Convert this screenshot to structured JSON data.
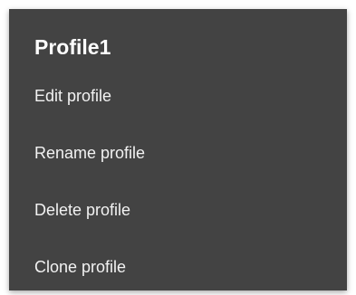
{
  "menu": {
    "title": "Profile1",
    "items": [
      {
        "label": "Edit profile"
      },
      {
        "label": "Rename profile"
      },
      {
        "label": "Delete profile"
      },
      {
        "label": "Clone profile"
      }
    ]
  },
  "colors": {
    "menu_background": "#434343",
    "text": "#ffffff"
  }
}
